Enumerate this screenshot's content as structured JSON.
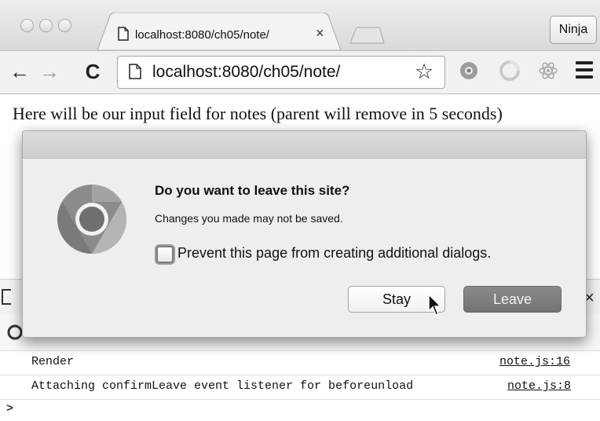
{
  "browser": {
    "tab": {
      "title": "localhost:8080/ch05/note/",
      "close_glyph": "×"
    },
    "profile_label": "Ninja",
    "nav": {
      "back_glyph": "←",
      "forward_glyph": "→",
      "reload_glyph": "C"
    },
    "address_bar": {
      "url": "localhost:8080/ch05/note/",
      "bookmark_glyph": "☆"
    },
    "extension_icons": [
      "extension-icon",
      "extension-icon",
      "react-devtools-icon"
    ],
    "menu_icon": "hamburger-icon"
  },
  "page": {
    "text": "Here will be our input field for notes (parent will remove in 5 seconds)"
  },
  "dialog": {
    "title": "Do you want to leave this site?",
    "message": "Changes you made may not be saved.",
    "checkbox_label": "Prevent this page from creating additional dialogs.",
    "checkbox_checked": false,
    "stay_label": "Stay",
    "leave_label": "Leave"
  },
  "devtools": {
    "close_glyph": "×",
    "console": [
      {
        "message": "Render",
        "source": "note.js:16"
      },
      {
        "message": "Attaching confirmLeave event listener for beforeunload",
        "source": "note.js:8"
      }
    ],
    "prompt_glyph": ">"
  },
  "colors": {
    "dialog_bg": "#eeeeee",
    "leave_button": "#7f7f7f",
    "chrome_logo_outer": "#8a8a8a",
    "chrome_logo_inner": "#6e6e6e"
  }
}
